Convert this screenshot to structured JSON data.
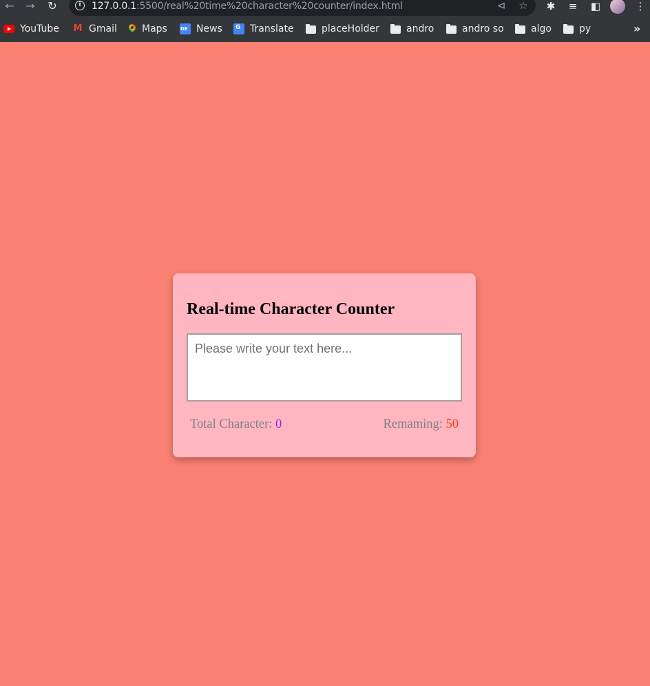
{
  "browser": {
    "url_host": "127.0.0.1",
    "url_rest": ":5500/real%20time%20character%20counter/index.html",
    "bookmarks": [
      {
        "label": "YouTube",
        "icon": "youtube-icon"
      },
      {
        "label": "Gmail",
        "icon": "gmail-icon"
      },
      {
        "label": "Maps",
        "icon": "maps-icon"
      },
      {
        "label": "News",
        "icon": "news-icon"
      },
      {
        "label": "Translate",
        "icon": "translate-icon"
      },
      {
        "label": "placeHolder",
        "icon": "folder-icon"
      },
      {
        "label": "andro",
        "icon": "folder-icon"
      },
      {
        "label": "andro so",
        "icon": "folder-icon"
      },
      {
        "label": "algo",
        "icon": "folder-icon"
      },
      {
        "label": "py",
        "icon": "folder-icon"
      }
    ]
  },
  "app": {
    "title": "Real-time Character Counter",
    "textarea": {
      "value": "",
      "placeholder": "Please write your text here..."
    },
    "total_label": "Total Character: ",
    "total_value": "0",
    "remaining_label": "Remaming: ",
    "remaining_value": "50"
  },
  "colors": {
    "page_background": "#fa8072",
    "card_background": "#ffb6c1",
    "total_value_color": "#8a2be2",
    "remaining_value_color": "#ff3a1a",
    "label_color": "#808080"
  }
}
